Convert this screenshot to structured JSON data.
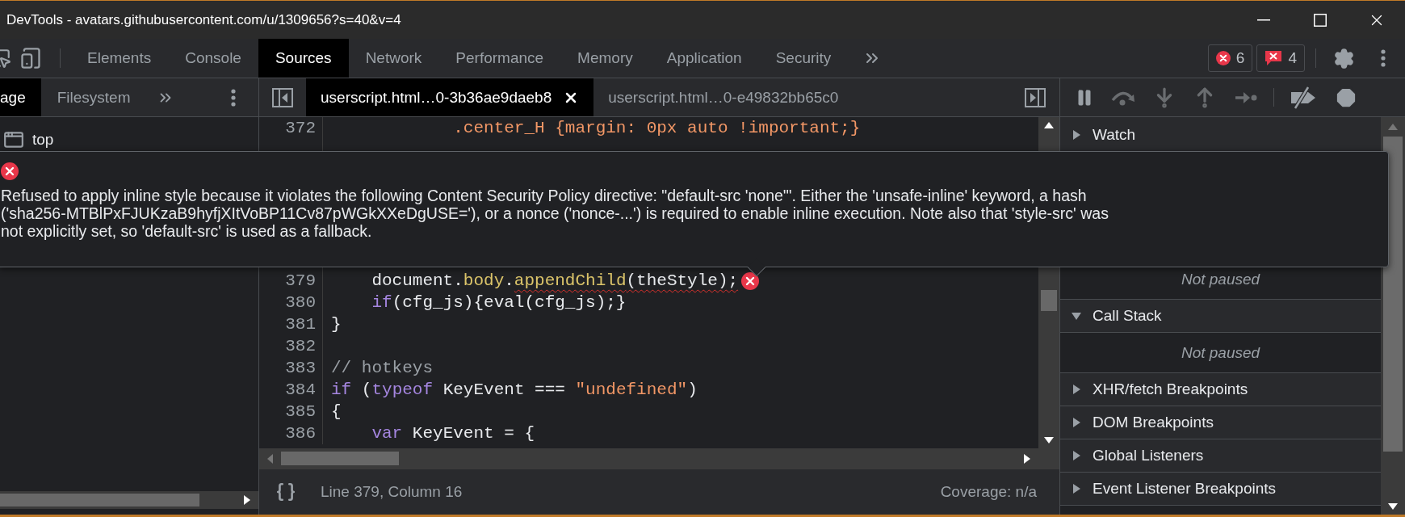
{
  "window": {
    "title": "DevTools - avatars.githubusercontent.com/u/1309656?s=40&v=4"
  },
  "toolbar": {
    "tabs": [
      {
        "label": "Elements",
        "selected": false
      },
      {
        "label": "Console",
        "selected": false
      },
      {
        "label": "Sources",
        "selected": true
      },
      {
        "label": "Network",
        "selected": false
      },
      {
        "label": "Performance",
        "selected": false
      },
      {
        "label": "Memory",
        "selected": false
      },
      {
        "label": "Application",
        "selected": false
      },
      {
        "label": "Security",
        "selected": false
      }
    ],
    "errors": "6",
    "warnings": "4"
  },
  "navigator": {
    "tabs": [
      {
        "label": "age",
        "selected": true
      },
      {
        "label": "Filesystem",
        "selected": false
      }
    ],
    "tree": [
      {
        "label": "top"
      }
    ]
  },
  "editor": {
    "tabs": [
      {
        "label": "userscript.html…0-3b36ae9daeb8",
        "selected": true,
        "closable": true
      },
      {
        "label": "userscript.html…0-e49832bb65c0",
        "selected": false,
        "closable": false
      }
    ],
    "lines": [
      {
        "number": "372",
        "tokens": [
          {
            "kind": "css",
            "text": "            .center_H {margin: 0px auto !important;}"
          }
        ]
      },
      {
        "number": "379",
        "error": true,
        "tokens": [
          {
            "kind": "plain",
            "text": "    document."
          },
          {
            "kind": "property",
            "text": "body"
          },
          {
            "kind": "plain",
            "text": "."
          },
          {
            "kind": "property",
            "text": "appendChild",
            "squiggle": true
          },
          {
            "kind": "plain",
            "text": "(theStyle);",
            "squiggle": true
          }
        ]
      },
      {
        "number": "380",
        "tokens": [
          {
            "kind": "keyword",
            "text": "    if"
          },
          {
            "kind": "plain",
            "text": "(cfg_js){eval(cfg_js);}"
          }
        ]
      },
      {
        "number": "381",
        "tokens": [
          {
            "kind": "plain",
            "text": "}"
          }
        ]
      },
      {
        "number": "382"
      },
      {
        "number": "383",
        "tokens": [
          {
            "kind": "comment",
            "text": "// hotkeys"
          }
        ]
      },
      {
        "number": "384",
        "tokens": [
          {
            "kind": "keyword",
            "text": "if"
          },
          {
            "kind": "plain",
            "text": " ("
          },
          {
            "kind": "keyword",
            "text": "typeof"
          },
          {
            "kind": "plain",
            "text": " KeyEvent === "
          },
          {
            "kind": "string",
            "text": "\"undefined\""
          },
          {
            "kind": "plain",
            "text": ")"
          }
        ]
      },
      {
        "number": "385",
        "tokens": [
          {
            "kind": "plain",
            "text": "{"
          }
        ]
      },
      {
        "number": "386",
        "tokens": [
          {
            "kind": "keyword",
            "text": "    var"
          },
          {
            "kind": "plain",
            "text": " KeyEvent = {"
          }
        ]
      }
    ],
    "status": {
      "position": "Line 379, Column 16",
      "coverage": "Coverage: n/a"
    }
  },
  "debugger": {
    "sections": [
      {
        "kind": "header",
        "title": "Watch",
        "expanded": false
      },
      {
        "kind": "message",
        "text": "Not paused"
      },
      {
        "kind": "header",
        "title": "Call Stack",
        "expanded": true
      },
      {
        "kind": "message",
        "text": "Not paused"
      },
      {
        "kind": "header",
        "title": "XHR/fetch Breakpoints",
        "expanded": false
      },
      {
        "kind": "header",
        "title": "DOM Breakpoints",
        "expanded": false
      },
      {
        "kind": "header",
        "title": "Global Listeners",
        "expanded": false
      },
      {
        "kind": "header",
        "title": "Event Listener Breakpoints",
        "expanded": false
      }
    ]
  },
  "tooltip": {
    "message": "Refused to apply inline style because it violates the following Content Security Policy directive: \"default-src 'none'\". Either the 'unsafe-inline' keyword, a hash ('sha256-MTBlPxFJUKzaB9hyfjXItVoBP11Cv87pWGkXXeDgUSE='), or a nonce ('nonce-...') is required to enable inline execution. Note also that 'style-src' was not explicitly set, so 'default-src' is used as a fallback."
  }
}
